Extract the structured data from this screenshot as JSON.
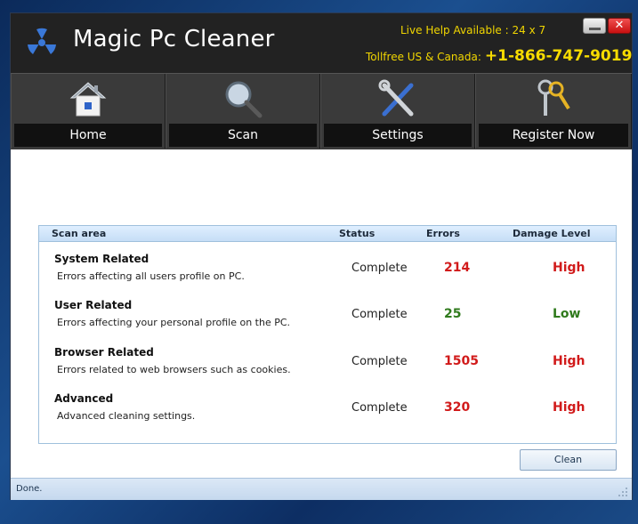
{
  "header": {
    "app_title": "Magic Pc Cleaner",
    "live_help": "Live Help Available : 24 x 7",
    "tollfree_label": "Tollfree US & Canada:",
    "phone": "+1-866-747-9019"
  },
  "nav": [
    {
      "label": "Home",
      "icon": "home-icon"
    },
    {
      "label": "Scan",
      "icon": "magnifier-icon"
    },
    {
      "label": "Settings",
      "icon": "tools-icon"
    },
    {
      "label": "Register Now",
      "icon": "keys-icon"
    }
  ],
  "table": {
    "headers": {
      "area": "Scan area",
      "status": "Status",
      "errors": "Errors",
      "damage": "Damage Level"
    },
    "rows": [
      {
        "title": "System Related",
        "desc": "Errors affecting all users profile on PC.",
        "status": "Complete",
        "errors": "214",
        "damage": "High",
        "errors_color": "#d11a1a",
        "damage_color": "#d11a1a"
      },
      {
        "title": "User Related",
        "desc": "Errors affecting your personal profile on the PC.",
        "status": "Complete",
        "errors": "25",
        "damage": "Low",
        "errors_color": "#2f7a1c",
        "damage_color": "#2f7a1c"
      },
      {
        "title": "Browser Related",
        "desc": "Errors related to web browsers such as cookies.",
        "status": "Complete",
        "errors": "1505",
        "damage": "High",
        "errors_color": "#d11a1a",
        "damage_color": "#d11a1a"
      },
      {
        "title": "Advanced",
        "desc": "Advanced cleaning settings.",
        "status": "Complete",
        "errors": "320",
        "damage": "High",
        "errors_color": "#d11a1a",
        "damage_color": "#d11a1a"
      }
    ]
  },
  "clean_button": "Clean",
  "status_text": "Done.",
  "colors": {
    "accent_yellow": "#f1d600",
    "high": "#d11a1a",
    "low": "#2f7a1c"
  }
}
